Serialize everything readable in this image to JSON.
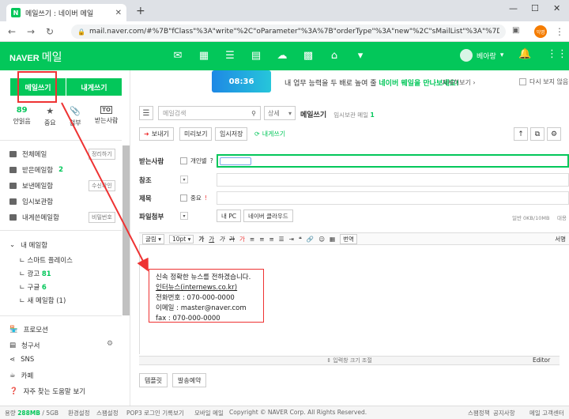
{
  "browser": {
    "tab_title": "메일쓰기 : 네이버 메일",
    "tab_favicon": "N",
    "url": "mail.naver.com/#%7B\"fClass\"%3A\"write\"%2C\"oParameter\"%3A%7B\"orderType\"%3A\"new\"%2C\"sMailList\"%3A\"%7D%7D",
    "profile": "익명"
  },
  "header": {
    "logo": "NAVER",
    "logo_service": "메일",
    "icons": [
      "mail-icon",
      "calendar-icon",
      "list-icon",
      "memo-icon",
      "cloud-icon",
      "grid-app-icon",
      "home-icon",
      "dropdown-icon"
    ],
    "user_name": "베아랑"
  },
  "banner": {
    "image_text": "08:36",
    "text": "내 업무 능력을 두 배로 높여 줄",
    "highlight": "네이버 웨일을 만나보세요!",
    "more": "자세히보기 ›",
    "hide_label": "다시 보지 않음"
  },
  "sidebar": {
    "write_btn": "메일쓰기",
    "self_btn": "내게쓰기",
    "quick": [
      {
        "label": "안읽음",
        "value": "89"
      },
      {
        "label": "중요",
        "icon": "★"
      },
      {
        "label": "첨부",
        "icon": "📎"
      },
      {
        "label": "받는사람",
        "icon": "TO"
      }
    ],
    "mailboxes": [
      {
        "label": "전체메일",
        "btn": "정리하기"
      },
      {
        "label": "받은메일함",
        "count": "2"
      },
      {
        "label": "보낸메일함",
        "btn": "수신확인"
      },
      {
        "label": "임시보관함"
      },
      {
        "label": "내게쓴메일함",
        "btn": "비밀번호"
      }
    ],
    "my_mailbox": "내 메일함",
    "subfolders": [
      {
        "label": "스마트 플레이스"
      },
      {
        "label": "광고",
        "count": "81"
      },
      {
        "label": "구글",
        "count": "6"
      },
      {
        "label": "새 메일함 (1)"
      }
    ],
    "extras": [
      "프로모션",
      "청구서",
      "SNS",
      "카페"
    ],
    "faq": "자주 찾는 도움말 보기"
  },
  "main": {
    "search_placeholder": "메일검색",
    "search_detail": "상세",
    "title": "메일쓰기",
    "title_sub": "임시보관 메일",
    "title_count": "1",
    "toolbar": {
      "send": "보내기",
      "preview": "미리보기",
      "save": "임시저장",
      "self": "내게쓰기"
    },
    "fields": {
      "to": "받는사람",
      "to_individual": "개인별",
      "cc": "참조",
      "subject": "제목",
      "important": "중요",
      "attach": "파일첨부",
      "my_pc": "내 PC",
      "naver_cloud": "네이버 클라우드",
      "capacity": "일반 0KB/10MB",
      "capacity2": "대용"
    },
    "editor_tools": [
      "굴림",
      "10pt",
      "가",
      "가",
      "가",
      "가",
      "가",
      "번역"
    ],
    "editor_right": "서명",
    "signature": [
      "신속 정확한 뉴스를 전하겠습니다.",
      "인터뉴스(internews.co.kr)",
      "전화번호 : 070-000-0000",
      "이메일 : master@naver.com",
      "fax : 070-000-0000"
    ],
    "resize_label": "입력창 크기 조절",
    "editor_tab": "Editor",
    "template": "템플릿",
    "scheduled": "발송예약"
  },
  "footer": {
    "storage": "288MB",
    "storage_total": "/ 5GB",
    "links": [
      "환경설정",
      "스팸설정",
      "POP3 로그인 기록보기",
      "모바일 메일",
      "Copyright © NAVER Corp. All Rights Reserved.",
      "스팸정책",
      "공지사항",
      "메일 고객센터"
    ]
  },
  "colors": {
    "brand": "#03c75a",
    "annotation": "#e33333"
  }
}
